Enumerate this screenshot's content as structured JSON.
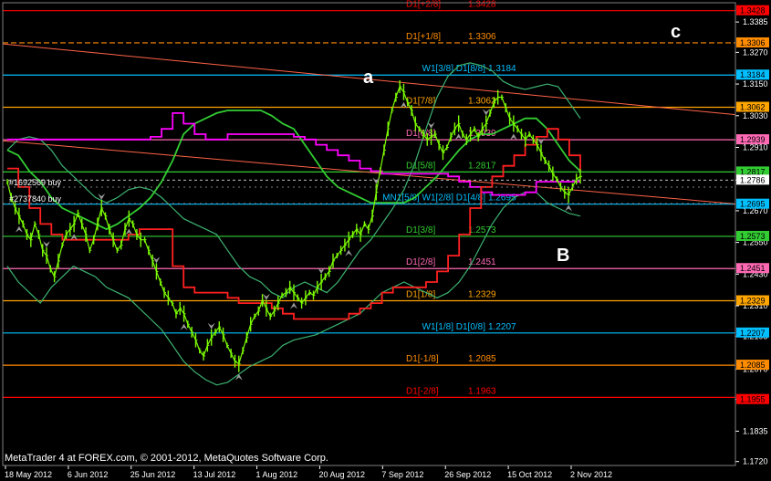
{
  "copyright": "MetaTrader 4 at FOREX.com, © 2001-2012, MetaQuotes Software Corp.",
  "wave_labels": {
    "a": "a",
    "b": "B",
    "c": "c"
  },
  "orders": [
    "#1692569 buy",
    "#2737840 buy"
  ],
  "chart_data": {
    "type": "line",
    "title": "",
    "ylim": [
      1.1705,
      1.3458
    ],
    "y_ticks": [
      "1.3385",
      "1.3270",
      "1.3150",
      "1.3030",
      "1.2910",
      "1.2786",
      "1.2670",
      "1.2550",
      "1.2430",
      "1.2310",
      "1.2195",
      "1.2070",
      "1.1955",
      "1.1835",
      "1.1720"
    ],
    "x_ticks": [
      "18 May 2012",
      "6 Jun 2012",
      "25 Jun 2012",
      "13 Jul 2012",
      "1 Aug 2012",
      "20 Aug 2012",
      "7 Sep 2012",
      "26 Sep 2012",
      "15 Oct 2012",
      "2 Nov 2012"
    ],
    "current_price": "1.2786",
    "levels": [
      {
        "name": "D1[+2/8]",
        "value": 1.3428,
        "text": "1.3428",
        "color": "#ff0000",
        "style": "solid"
      },
      {
        "name": "D1[+1/8]",
        "value": 1.3306,
        "text": "1.3306",
        "color": "#ff8c00",
        "style": "dash"
      },
      {
        "name": "W1[3/8] D1[8/8]",
        "value": 1.3184,
        "text": "1.3184",
        "color": "#00bfff",
        "style": "solid"
      },
      {
        "name": "D1[7/8]",
        "value": 1.3062,
        "text": "1.3062",
        "color": "#ffa500",
        "style": "solid"
      },
      {
        "name": "D1[6/8]",
        "value": 1.2939,
        "text": "1.2939",
        "color": "#ff69b4",
        "style": "solid"
      },
      {
        "name": "D1[5/8]",
        "value": 1.2817,
        "text": "1.2817",
        "color": "#32cd32",
        "style": "solid"
      },
      {
        "name": "MN1[5/8] W1[2/8] D1[4/8]",
        "value": 1.2695,
        "text": "1.2695",
        "color": "#00bfff",
        "style": "solid"
      },
      {
        "name": "D1[3/8]",
        "value": 1.2573,
        "text": "1.2573",
        "color": "#32cd32",
        "style": "solid"
      },
      {
        "name": "D1[2/8]",
        "value": 1.2451,
        "text": "1.2451",
        "color": "#ff69b4",
        "style": "solid"
      },
      {
        "name": "D1[1/8]",
        "value": 1.2329,
        "text": "1.2329",
        "color": "#ffa500",
        "style": "solid"
      },
      {
        "name": "W1[1/8] D1[0/8]",
        "value": 1.2207,
        "text": "1.2207",
        "color": "#00bfff",
        "style": "solid"
      },
      {
        "name": "D1[-1/8]",
        "value": 1.2085,
        "text": "1.2085",
        "color": "#ff8c00",
        "style": "solid"
      },
      {
        "name": "D1[-2/8]",
        "value": 1.1963,
        "text": "1.1963",
        "color": "#ff0000",
        "style": "solid"
      }
    ],
    "right_tags": [
      {
        "text": "1.3428",
        "value": 1.3428,
        "bg": "#ff0000"
      },
      {
        "text": "1.3306",
        "value": 1.3306,
        "bg": "#ff8c00"
      },
      {
        "text": "1.3184",
        "value": 1.3184,
        "bg": "#00bfff"
      },
      {
        "text": "1.3062",
        "value": 1.3062,
        "bg": "#ffa500"
      },
      {
        "text": "1.2939",
        "value": 1.2939,
        "bg": "#ff69b4"
      },
      {
        "text": "1.2817",
        "value": 1.2817,
        "bg": "#32cd32"
      },
      {
        "text": "1.2786",
        "value": 1.2786,
        "bg": "#ffffff"
      },
      {
        "text": "1.2695",
        "value": 1.2695,
        "bg": "#00bfff"
      },
      {
        "text": "1.2573",
        "value": 1.2573,
        "bg": "#32cd32"
      },
      {
        "text": "1.2451",
        "value": 1.2451,
        "bg": "#ff69b4"
      },
      {
        "text": "1.2329",
        "value": 1.2329,
        "bg": "#ffa500"
      },
      {
        "text": "1.2207",
        "value": 1.2207,
        "bg": "#00bfff"
      },
      {
        "text": "1.2085",
        "value": 1.2085,
        "bg": "#ff8c00"
      },
      {
        "text": "1.1955",
        "value": 1.1955,
        "bg": "#ff0000"
      }
    ],
    "price_series": {
      "name": "EURUSD D1",
      "color": "#7cfc00",
      "values": [
        1.278,
        1.272,
        1.268,
        1.265,
        1.262,
        1.258,
        1.256,
        1.262,
        1.258,
        1.252,
        1.25,
        1.245,
        1.242,
        1.248,
        1.254,
        1.258,
        1.26,
        1.262,
        1.266,
        1.262,
        1.258,
        1.252,
        1.256,
        1.262,
        1.268,
        1.265,
        1.26,
        1.256,
        1.252,
        1.254,
        1.26,
        1.264,
        1.262,
        1.258,
        1.256,
        1.256,
        1.252,
        1.248,
        1.244,
        1.24,
        1.236,
        1.234,
        1.232,
        1.228,
        1.23,
        1.228,
        1.224,
        1.221,
        1.218,
        1.214,
        1.212,
        1.216,
        1.219,
        1.221,
        1.223,
        1.22,
        1.216,
        1.213,
        1.21,
        1.209,
        1.214,
        1.219,
        1.224,
        1.227,
        1.229,
        1.233,
        1.23,
        1.227,
        1.229,
        1.232,
        1.235,
        1.236,
        1.238,
        1.236,
        1.234,
        1.232,
        1.234,
        1.236,
        1.235,
        1.238,
        1.24,
        1.242,
        1.244,
        1.248,
        1.25,
        1.252,
        1.254,
        1.256,
        1.258,
        1.26,
        1.258,
        1.262,
        1.26,
        1.265,
        1.274,
        1.282,
        1.29,
        1.298,
        1.305,
        1.31,
        1.314,
        1.312,
        1.308,
        1.305,
        1.3,
        1.298,
        1.296,
        1.294,
        1.295,
        1.296,
        1.292,
        1.289,
        1.291,
        1.295,
        1.298,
        1.3,
        1.296,
        1.294,
        1.296,
        1.298,
        1.295,
        1.298,
        1.3,
        1.304,
        1.308,
        1.31,
        1.31,
        1.306,
        1.302,
        1.3,
        1.298,
        1.296,
        1.294,
        1.296,
        1.294,
        1.292,
        1.289,
        1.286,
        1.284,
        1.281,
        1.279,
        1.276,
        1.274,
        1.273,
        1.276,
        1.279,
        1.28
      ]
    },
    "indicators": [
      {
        "name": "upper band",
        "color": "#3cb371",
        "values": [
          1.29,
          1.294,
          1.295,
          1.294,
          1.29,
          1.284,
          1.28,
          1.276,
          1.272,
          1.27,
          1.272,
          1.275,
          1.276,
          1.275,
          1.272,
          1.268,
          1.264,
          1.262,
          1.26,
          1.258,
          1.252,
          1.246,
          1.242,
          1.24,
          1.236,
          1.234,
          1.238,
          1.24,
          1.238,
          1.236,
          1.24,
          1.246,
          1.252,
          1.256,
          1.262,
          1.268,
          1.275,
          1.285,
          1.298,
          1.31,
          1.318,
          1.322,
          1.323,
          1.322,
          1.32,
          1.316,
          1.314,
          1.313,
          1.314,
          1.315,
          1.314,
          1.308,
          1.302
        ]
      },
      {
        "name": "lower band",
        "color": "#3cb371",
        "values": [
          1.246,
          1.24,
          1.236,
          1.232,
          1.238,
          1.242,
          1.246,
          1.244,
          1.242,
          1.238,
          1.236,
          1.234,
          1.23,
          1.226,
          1.222,
          1.216,
          1.21,
          1.206,
          1.203,
          1.201,
          1.202,
          1.205,
          1.208,
          1.21,
          1.212,
          1.216,
          1.218,
          1.219,
          1.22,
          1.222,
          1.224,
          1.226,
          1.228,
          1.232,
          1.236,
          1.238,
          1.24,
          1.238,
          1.236,
          1.234,
          1.236,
          1.24,
          1.246,
          1.254,
          1.262,
          1.268,
          1.272,
          1.274,
          1.274,
          1.27,
          1.268,
          1.266,
          1.265
        ]
      },
      {
        "name": "moving average",
        "color": "#32cd32",
        "values": [
          1.29,
          1.288,
          1.282,
          1.278,
          1.272,
          1.268,
          1.266,
          1.264,
          1.262,
          1.26,
          1.262,
          1.265,
          1.268,
          1.272,
          1.278,
          1.286,
          1.296,
          1.3,
          1.302,
          1.304,
          1.305,
          1.305,
          1.305,
          1.305,
          1.303,
          1.3,
          1.298,
          1.292,
          1.286,
          1.28,
          1.276,
          1.274,
          1.272,
          1.27,
          1.27,
          1.27,
          1.27,
          1.272,
          1.276,
          1.28,
          1.285,
          1.29,
          1.294,
          1.296,
          1.296,
          1.298,
          1.3,
          1.302,
          1.302,
          1.298,
          1.292,
          1.286,
          1.282
        ]
      },
      {
        "name": "magenta step",
        "color": "#ff00ff",
        "values": [
          1.294,
          1.294,
          1.294,
          1.294,
          1.294,
          1.294,
          1.294,
          1.294,
          1.294,
          1.294,
          1.294,
          1.294,
          1.294,
          1.295,
          1.298,
          1.304,
          1.3,
          1.296,
          1.294,
          1.294,
          1.296,
          1.296,
          1.296,
          1.296,
          1.296,
          1.296,
          1.295,
          1.294,
          1.292,
          1.29,
          1.288,
          1.286,
          1.283,
          1.282,
          1.281,
          1.281,
          1.281,
          1.281,
          1.281,
          1.281,
          1.28,
          1.278,
          1.276,
          1.274,
          1.273,
          1.273,
          1.273,
          1.274,
          1.278,
          1.278,
          1.278,
          1.278,
          1.278
        ]
      },
      {
        "name": "red step",
        "color": "#ff2020",
        "values": [
          1.283,
          1.276,
          1.268,
          1.262,
          1.258,
          1.256,
          1.256,
          1.256,
          1.256,
          1.256,
          1.256,
          1.258,
          1.26,
          1.26,
          1.26,
          1.246,
          1.238,
          1.236,
          1.236,
          1.236,
          1.234,
          1.232,
          1.232,
          1.232,
          1.23,
          1.228,
          1.226,
          1.226,
          1.226,
          1.226,
          1.226,
          1.228,
          1.23,
          1.232,
          1.236,
          1.238,
          1.238,
          1.238,
          1.24,
          1.244,
          1.25,
          1.258,
          1.268,
          1.276,
          1.28,
          1.284,
          1.288,
          1.292,
          1.295,
          1.298,
          1.294,
          1.288,
          1.282
        ]
      }
    ],
    "trendlines": [
      {
        "color": "#ff6347",
        "from": [
          0,
          1.3302
        ],
        "to": [
          1,
          1.3034
        ]
      },
      {
        "color": "#ff6347",
        "from": [
          0,
          1.2935
        ],
        "to": [
          1,
          1.2696
        ]
      }
    ]
  }
}
